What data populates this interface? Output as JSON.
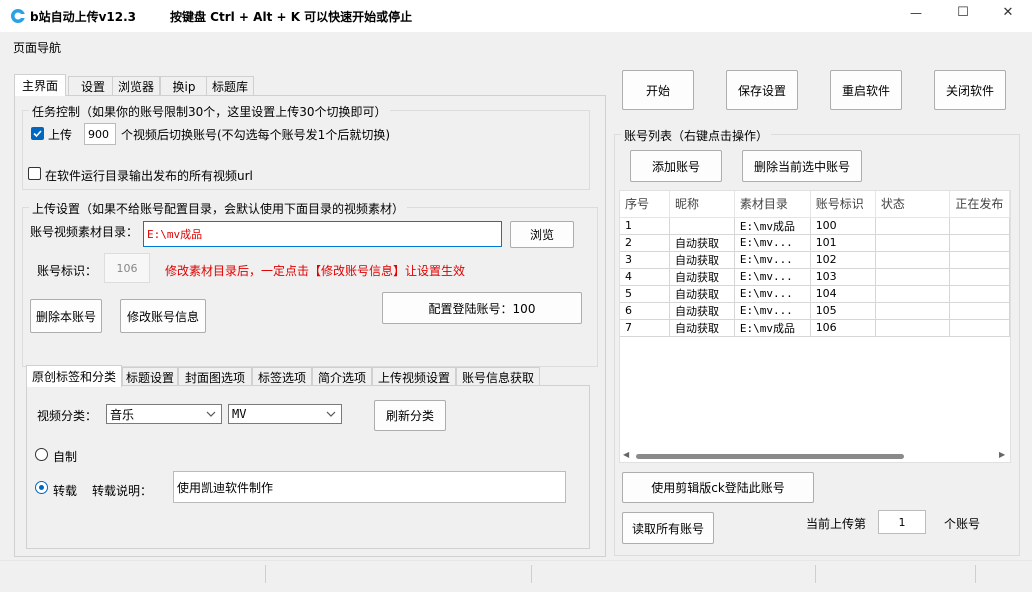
{
  "window": {
    "title": "b站自动上传v12.3",
    "hotkey_hint": "按键盘 Ctrl + Alt + K  可以快速开始或停止",
    "minimize": "—",
    "maximize": "☐",
    "close": "✕"
  },
  "menu": {
    "nav": "页面导航"
  },
  "tabs": [
    "主界面",
    "设置",
    "浏览器",
    "换ip",
    "标题库"
  ],
  "task": {
    "group_title": "任务控制（如果你的账号限制30个，这里设置上传30个切换即可）",
    "upload_label": "上传",
    "upload_count": "900",
    "switch_hint": "个视频后切换账号(不勾选每个账号发1个后就切换)",
    "output_url_label": "在软件运行目录输出发布的所有视频url"
  },
  "upload": {
    "group_title": "上传设置（如果不给账号配置目录，会默认使用下面目录的视频素材）",
    "dir_label": "账号视频素材目录：",
    "dir_value": "E:\\mv成品",
    "browse": "浏览",
    "account_id_label": "账号标识：",
    "account_id_value": "106",
    "warning": "修改素材目录后，一定点击【修改账号信息】让设置生效",
    "delete_account": "删除本账号",
    "modify_account": "修改账号信息",
    "login_account": "配置登陆账号：100"
  },
  "subtabs": [
    "原创标签和分类",
    "标题设置",
    "封面图选项",
    "标签选项",
    "简介选项",
    "上传视频设置",
    "账号信息获取"
  ],
  "category": {
    "label": "视频分类：",
    "main": "音乐",
    "sub": "MV",
    "refresh": "刷新分类",
    "self_made": "自制",
    "repost": "转载",
    "repost_note_label": "转载说明：",
    "repost_note": "使用凯迪软件制作"
  },
  "actions": {
    "start": "开始",
    "save": "保存设置",
    "restart": "重启软件",
    "close_app": "关闭软件"
  },
  "accounts": {
    "group_title": "账号列表（右键点击操作）",
    "add": "添加账号",
    "delete_selected": "删除当前选中账号",
    "columns": [
      "序号",
      "昵称",
      "素材目录",
      "账号标识",
      "状态",
      "正在发布"
    ],
    "rows": [
      [
        "1",
        "",
        "E:\\mv成品",
        "100",
        "",
        ""
      ],
      [
        "2",
        "自动获取",
        "E:\\mv...",
        "101",
        "",
        ""
      ],
      [
        "3",
        "自动获取",
        "E:\\mv...",
        "102",
        "",
        ""
      ],
      [
        "4",
        "自动获取",
        "E:\\mv...",
        "103",
        "",
        ""
      ],
      [
        "5",
        "自动获取",
        "E:\\mv...",
        "104",
        "",
        ""
      ],
      [
        "6",
        "自动获取",
        "E:\\mv...",
        "105",
        "",
        ""
      ],
      [
        "7",
        "自动获取",
        "E:\\mv成品",
        "106",
        "",
        ""
      ]
    ],
    "clip_login": "使用剪辑版ck登陆此账号",
    "read_all": "读取所有账号",
    "current_prefix": "当前上传第",
    "current_value": "1",
    "current_suffix": "个账号"
  },
  "colors": {
    "accent": "#0067c0",
    "warning": "#e00000",
    "input_border_focus": "#0078d7"
  }
}
